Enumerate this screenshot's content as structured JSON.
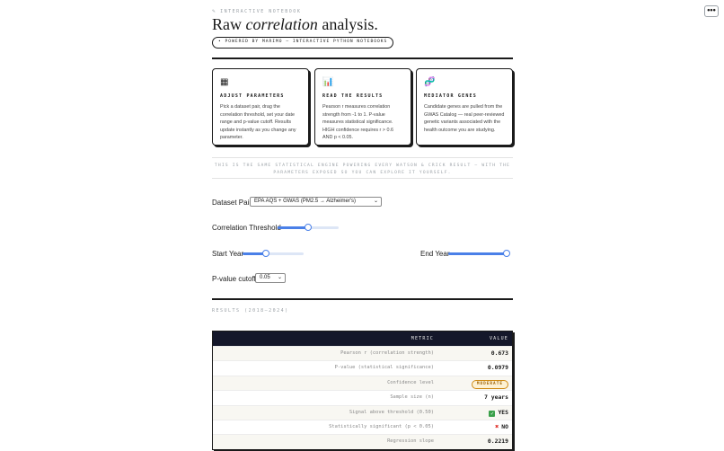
{
  "header": {
    "kicker": "INTERACTIVE NOTEBOOK",
    "kicker_icon": "pencil-icon",
    "title_pre": "Raw ",
    "title_em": "correlation",
    "title_post": " analysis.",
    "pill": "• POWERED BY MARIMO — INTERACTIVE PYTHON NOTEBOOKS"
  },
  "menu": {
    "label": "•••"
  },
  "cards": [
    {
      "icon": "grid-icon",
      "glyph": "▦",
      "title": "ADJUST PARAMETERS",
      "body": "Pick a dataset pair, drag the correlation threshold, set your date range and p-value cutoff. Results update instantly as you change any parameter."
    },
    {
      "icon": "bar-chart-icon",
      "glyph": "📊",
      "title": "READ THE RESULTS",
      "body": "Pearson r measures correlation strength from -1 to 1. P-value measures statistical significance. HIGH confidence requires r > 0.6 AND p < 0.05."
    },
    {
      "icon": "dna-icon",
      "glyph": "🧬",
      "title": "MEDIATOR GENES",
      "body": "Candidate genes are pulled from the GWAS Catalog — real peer-reviewed genetic variants associated with the health outcome you are studying."
    }
  ],
  "note": "THIS IS THE SAME STATISTICAL ENGINE POWERING EVERY WATSON & CRICK RESULT — WITH THE PARAMETERS EXPOSED SO YOU CAN EXPLORE IT YOURSELF.",
  "controls": {
    "dataset_label": "Dataset Pair",
    "dataset_value": "EPA AQS + GWAS (PM2.5 → Alzheimer's)",
    "threshold_label": "Correlation Threshold",
    "threshold_level": 0.5,
    "start_label": "Start Year",
    "start_level": 0.38,
    "end_label": "End Year",
    "end_level": 1.0,
    "pvalue_label": "P-value cutoff",
    "pvalue_value": "0.05"
  },
  "results": {
    "label": "RESULTS (2018–2024)",
    "col_metric": "METRIC",
    "col_value": "VALUE",
    "rows": [
      {
        "metric": "Pearson r (correlation strength)",
        "value": "0.673"
      },
      {
        "metric": "P-value (statistical significance)",
        "value": "0.0979"
      },
      {
        "metric": "Confidence level",
        "value": "MODERATE",
        "badge": true
      },
      {
        "metric": "Sample size (n)",
        "value": "7 years"
      },
      {
        "metric": "Signal above threshold (0.50)",
        "value": "YES",
        "mark": "check"
      },
      {
        "metric": "Statistically significant (p < 0.05)",
        "value": "NO",
        "mark": "cross"
      },
      {
        "metric": "Regression slope",
        "value": "0.2219"
      }
    ]
  },
  "colors": {
    "accent": "#4a80e8",
    "ink": "#1a1a1a",
    "table_header": "#14172a",
    "badge": "#d08b14"
  }
}
